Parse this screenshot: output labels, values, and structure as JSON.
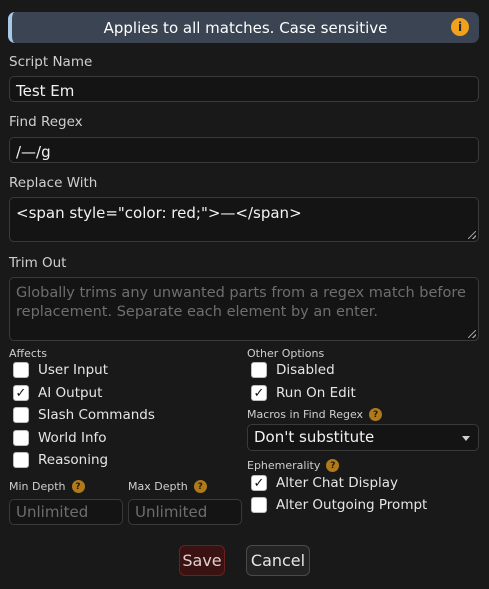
{
  "banner": {
    "text": "Applies to all matches. Case sensitive",
    "icon": "info-icon"
  },
  "script_name": {
    "label": "Script Name",
    "value": "Test Em"
  },
  "find_regex": {
    "label": "Find Regex",
    "value": "/—/g"
  },
  "replace_with": {
    "label": "Replace With",
    "value": "<span style=\"color: red;\">—</span>"
  },
  "trim_out": {
    "label": "Trim Out",
    "placeholder": "Globally trims any unwanted parts from a regex match before replacement. Separate each element by an enter."
  },
  "affects": {
    "label": "Affects",
    "items": [
      {
        "label": "User Input",
        "checked": false
      },
      {
        "label": "AI Output",
        "checked": true
      },
      {
        "label": "Slash Commands",
        "checked": false
      },
      {
        "label": "World Info",
        "checked": false
      },
      {
        "label": "Reasoning",
        "checked": false
      }
    ]
  },
  "other_options": {
    "label": "Other Options",
    "items": [
      {
        "label": "Disabled",
        "checked": false
      },
      {
        "label": "Run On Edit",
        "checked": true
      }
    ]
  },
  "macros": {
    "label": "Macros in Find Regex",
    "selected": "Don't substitute"
  },
  "ephemerality": {
    "label": "Ephemerality",
    "items": [
      {
        "label": "Alter Chat Display",
        "checked": true
      },
      {
        "label": "Alter Outgoing Prompt",
        "checked": false
      }
    ]
  },
  "min_depth": {
    "label": "Min Depth",
    "placeholder": "Unlimited"
  },
  "max_depth": {
    "label": "Max Depth",
    "placeholder": "Unlimited"
  },
  "buttons": {
    "save": "Save",
    "cancel": "Cancel"
  },
  "colors": {
    "accent_bar": "#a9c7e6",
    "info": "#f0a21b",
    "save_bg": "#3a1212"
  }
}
